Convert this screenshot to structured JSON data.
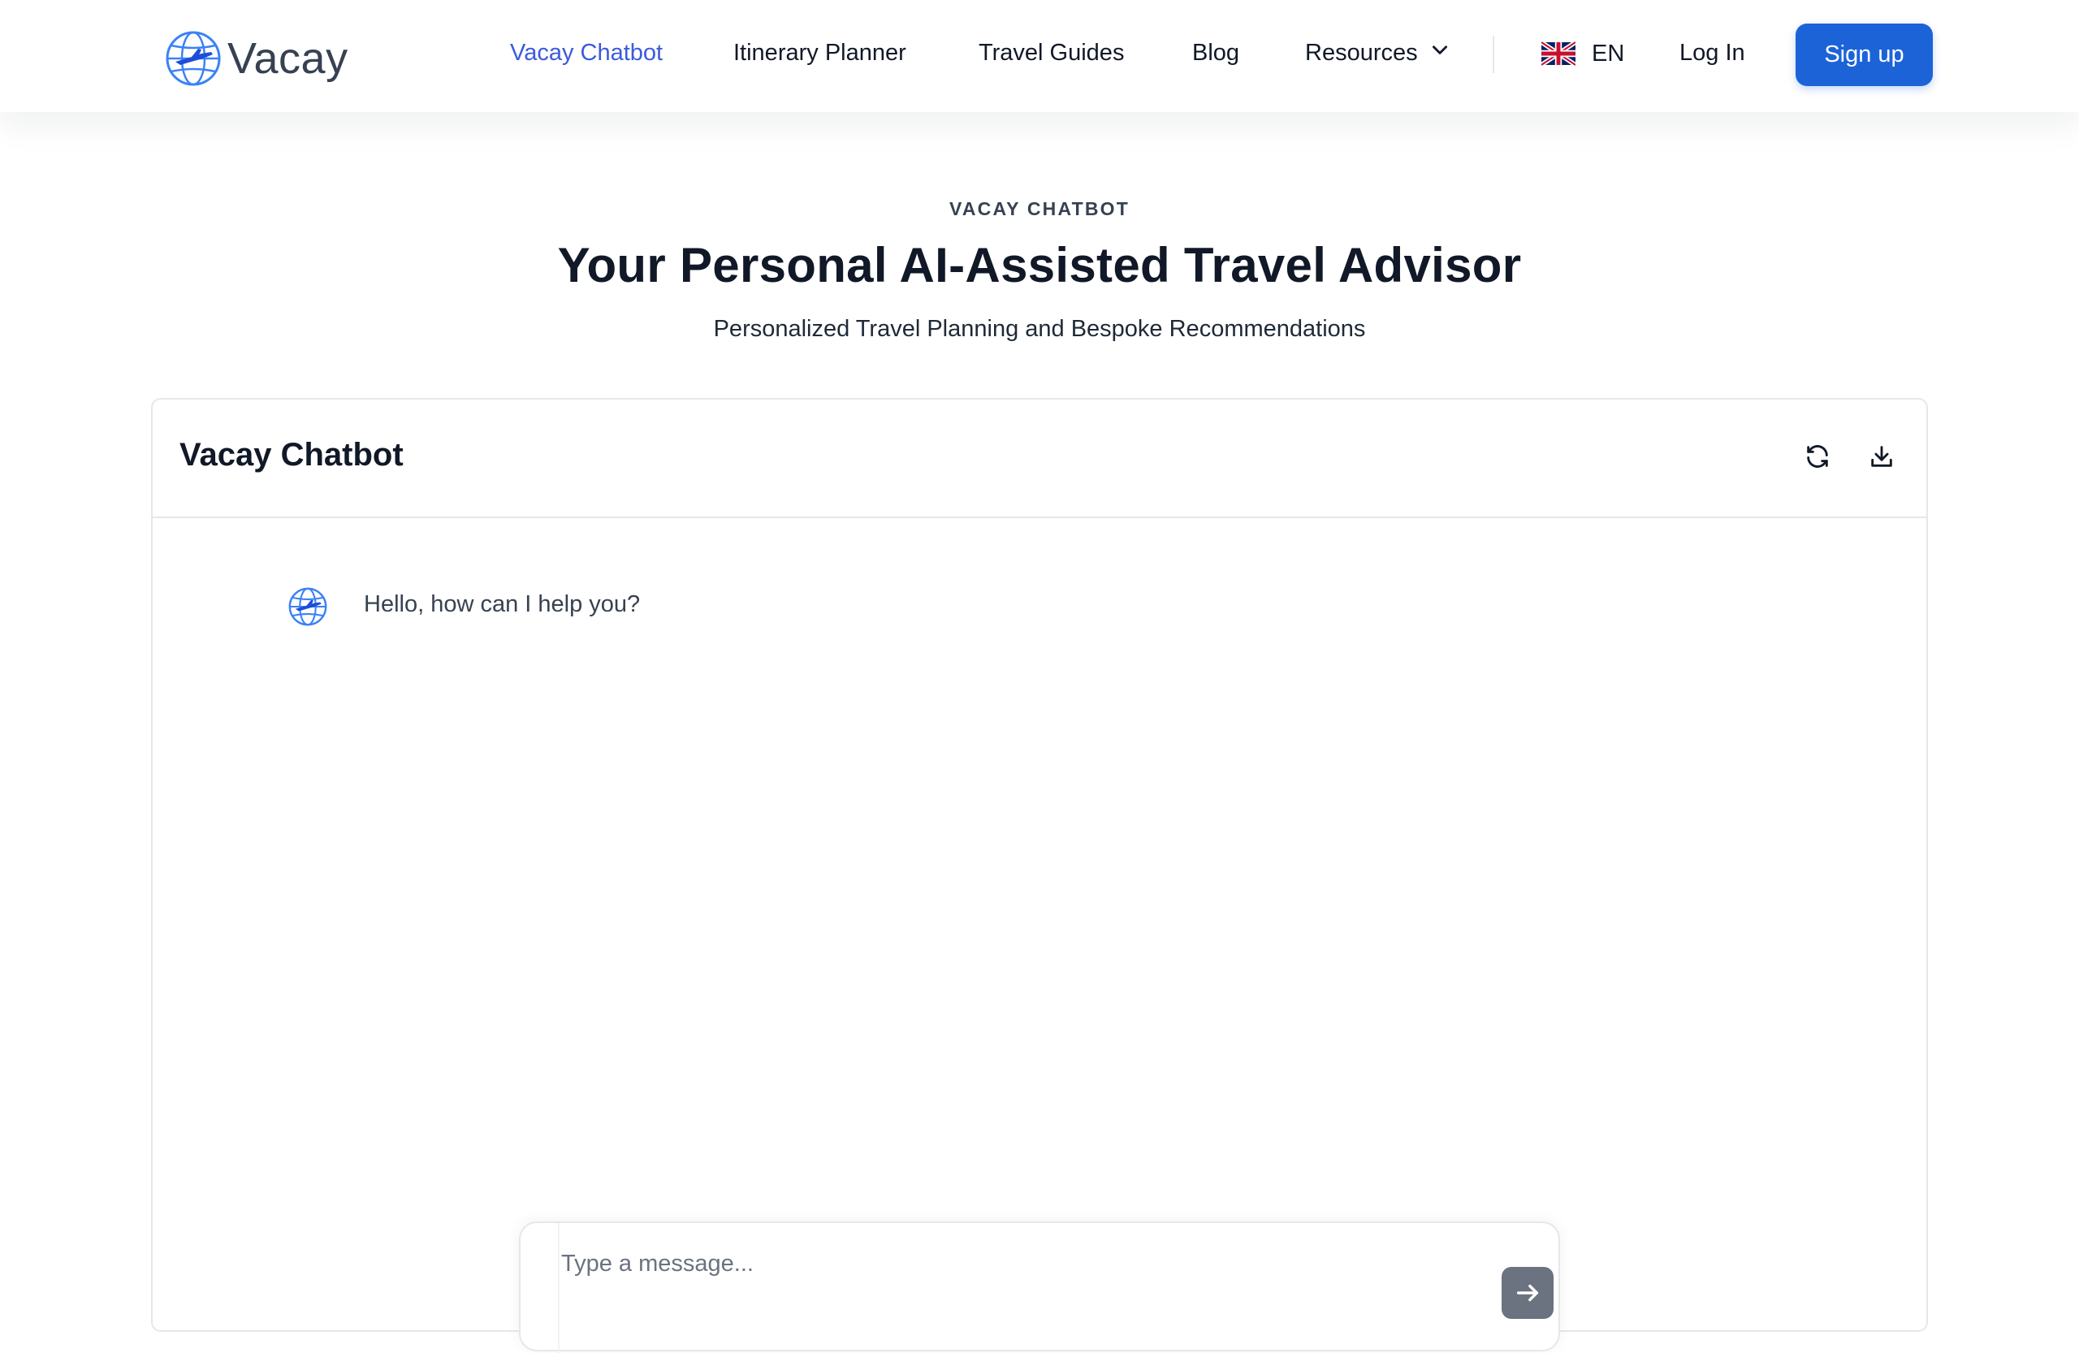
{
  "brand": {
    "name": "Vacay",
    "logo_icon": "globe-airplane-icon",
    "accent_color": "#1c63d8",
    "active_link_color": "#3b5bdb"
  },
  "nav": {
    "links": [
      {
        "label": "Vacay Chatbot",
        "active": true
      },
      {
        "label": "Itinerary Planner",
        "active": false
      },
      {
        "label": "Travel Guides",
        "active": false
      },
      {
        "label": "Blog",
        "active": false
      }
    ],
    "resources_label": "Resources",
    "language": {
      "code": "EN",
      "flag_icon": "uk-flag-icon"
    },
    "login_label": "Log In",
    "signup_label": "Sign up"
  },
  "hero": {
    "eyebrow": "VACAY CHATBOT",
    "title": "Your Personal AI-Assisted Travel Advisor",
    "subtitle": "Personalized Travel Planning and Bespoke Recommendations"
  },
  "chat": {
    "title": "Vacay Chatbot",
    "actions": [
      {
        "name": "refresh",
        "icon": "refresh-icon"
      },
      {
        "name": "download",
        "icon": "download-icon"
      }
    ],
    "messages": [
      {
        "sender": "bot",
        "avatar_icon": "globe-airplane-icon",
        "text": "Hello, how can I help you?"
      }
    ],
    "input": {
      "placeholder": "Type a message...",
      "value": "",
      "send_icon": "arrow-right-icon"
    }
  }
}
